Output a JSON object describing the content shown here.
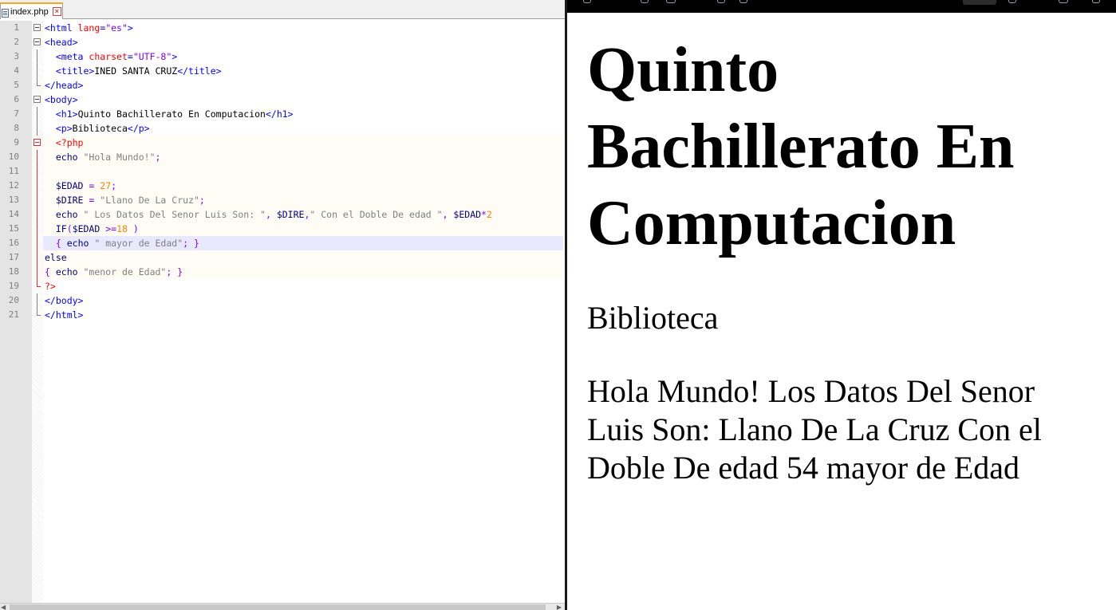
{
  "editor": {
    "tab_label": "index.php",
    "lines": [
      {
        "n": "1",
        "fold": "open",
        "segs": [
          [
            "tag",
            "<html "
          ],
          [
            "attr",
            "lang"
          ],
          [
            "tag",
            "="
          ],
          [
            "str",
            "\"es\""
          ],
          [
            "tag",
            ">"
          ]
        ]
      },
      {
        "n": "2",
        "fold": "open",
        "segs": [
          [
            "tag",
            "<head>"
          ]
        ]
      },
      {
        "n": "3",
        "fold": "line",
        "segs": [
          [
            "plain",
            "  "
          ],
          [
            "tag",
            "<meta "
          ],
          [
            "attr",
            "charset"
          ],
          [
            "tag",
            "="
          ],
          [
            "str",
            "\"UTF-8\""
          ],
          [
            "tag",
            ">"
          ]
        ]
      },
      {
        "n": "4",
        "fold": "line",
        "segs": [
          [
            "plain",
            "  "
          ],
          [
            "tag",
            "<title>"
          ],
          [
            "plain",
            "INED SANTA CRUZ"
          ],
          [
            "tag",
            "</title>"
          ]
        ]
      },
      {
        "n": "5",
        "fold": "end",
        "segs": [
          [
            "tag",
            "</head>"
          ]
        ]
      },
      {
        "n": "6",
        "fold": "open",
        "segs": [
          [
            "tag",
            "<body>"
          ]
        ]
      },
      {
        "n": "7",
        "fold": "line",
        "segs": [
          [
            "plain",
            "  "
          ],
          [
            "tag",
            "<h1>"
          ],
          [
            "plain",
            "Quinto Bachillerato En Computacion"
          ],
          [
            "tag",
            "</h1>"
          ]
        ]
      },
      {
        "n": "8",
        "fold": "line",
        "segs": [
          [
            "plain",
            "  "
          ],
          [
            "tag",
            "<p>"
          ],
          [
            "plain",
            "Biblioteca"
          ],
          [
            "tag",
            "</p>"
          ]
        ]
      },
      {
        "n": "9",
        "fold": "openred",
        "bg": "php",
        "segs": [
          [
            "plain",
            "  "
          ],
          [
            "php",
            "<?php"
          ]
        ]
      },
      {
        "n": "10",
        "fold": "linered",
        "bg": "php",
        "segs": [
          [
            "plain",
            "  "
          ],
          [
            "kw",
            "echo "
          ],
          [
            "pstr",
            "\"Hola Mundo!\""
          ],
          [
            "op",
            ";"
          ]
        ]
      },
      {
        "n": "11",
        "fold": "linered",
        "bg": "php",
        "segs": [
          [
            "plain",
            ""
          ]
        ]
      },
      {
        "n": "12",
        "fold": "linered",
        "bg": "php",
        "segs": [
          [
            "plain",
            "  "
          ],
          [
            "var",
            "$EDAD "
          ],
          [
            "op",
            "= "
          ],
          [
            "num",
            "27"
          ],
          [
            "op",
            ";"
          ]
        ]
      },
      {
        "n": "13",
        "fold": "linered",
        "bg": "php",
        "segs": [
          [
            "plain",
            "  "
          ],
          [
            "var",
            "$DIRE "
          ],
          [
            "op",
            "= "
          ],
          [
            "pstr",
            "\"Llano De La Cruz\""
          ],
          [
            "op",
            ";"
          ]
        ]
      },
      {
        "n": "14",
        "fold": "linered",
        "bg": "php",
        "segs": [
          [
            "plain",
            "  "
          ],
          [
            "kw",
            "echo "
          ],
          [
            "pstr",
            "\" Los Datos Del Senor Luis Son: \""
          ],
          [
            "op",
            ", "
          ],
          [
            "var",
            "$DIRE"
          ],
          [
            "op",
            ","
          ],
          [
            "pstr",
            "\" Con el Doble De edad \""
          ],
          [
            "op",
            ", "
          ],
          [
            "var",
            "$EDAD"
          ],
          [
            "op",
            "*"
          ],
          [
            "num",
            "2"
          ]
        ]
      },
      {
        "n": "15",
        "fold": "linered",
        "bg": "php",
        "segs": [
          [
            "plain",
            "  "
          ],
          [
            "kw",
            "IF"
          ],
          [
            "op",
            "("
          ],
          [
            "var",
            "$EDAD "
          ],
          [
            "op",
            ">="
          ],
          [
            "num",
            "18 "
          ],
          [
            "op",
            ")"
          ]
        ]
      },
      {
        "n": "16",
        "fold": "linered",
        "bg": "cur",
        "segs": [
          [
            "plain",
            "  "
          ],
          [
            "op",
            "{ "
          ],
          [
            "kw",
            "echo "
          ],
          [
            "pstr",
            "\" mayor de Edad\""
          ],
          [
            "op",
            "; }"
          ]
        ]
      },
      {
        "n": "17",
        "fold": "linered",
        "bg": "php",
        "segs": [
          [
            "kw",
            "else"
          ]
        ]
      },
      {
        "n": "18",
        "fold": "linered",
        "bg": "php",
        "segs": [
          [
            "op",
            "{ "
          ],
          [
            "kw",
            "echo "
          ],
          [
            "pstr",
            "\"menor de Edad\""
          ],
          [
            "op",
            "; }"
          ]
        ]
      },
      {
        "n": "19",
        "fold": "endred",
        "segs": [
          [
            "php",
            "?>"
          ]
        ]
      },
      {
        "n": "20",
        "fold": "line",
        "segs": [
          [
            "tag",
            "</body>"
          ]
        ]
      },
      {
        "n": "21",
        "fold": "end",
        "segs": [
          [
            "tag",
            "</html>"
          ]
        ]
      }
    ]
  },
  "browser": {
    "heading": "Quinto Bachillerato En Computacion",
    "paragraph": "Biblioteca",
    "output": "Hola Mundo! Los Datos Del Senor Luis Son: Llano De La Cruz Con el Doble De edad 54 mayor de Edad"
  },
  "colors": {
    "tag": "#0000ff",
    "attr": "#ff0000",
    "string": "#8000ff",
    "php_delim": "#ff0000",
    "number": "#ff8000",
    "php_string": "#808080",
    "current_line": "#e8e8ff"
  }
}
